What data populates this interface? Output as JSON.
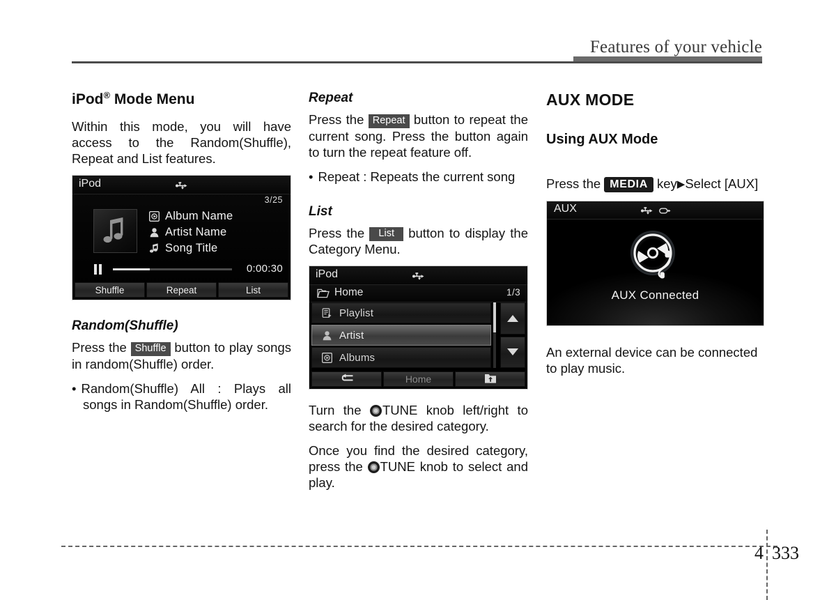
{
  "header": {
    "title": "Features of your vehicle"
  },
  "footer": {
    "chapter": "4",
    "page": "333"
  },
  "left_column": {
    "section_title": "iPod",
    "section_title_sup": "®",
    "section_title_rest": " Mode Menu",
    "intro": "Within this mode, you will have access to the Random(Shuffle), Repeat and List features.",
    "ipod_screen": {
      "title": "iPod",
      "usb_icon": "usb-icon",
      "track_count": "3/25",
      "album_icon": "album-icon",
      "album_label": "Album Name",
      "artist_icon": "artist-icon",
      "artist_label": "Artist Name",
      "song_icon": "music-note-icon",
      "song_label": "Song Title",
      "pause_icon": "pause-icon",
      "progress_percent": 31,
      "elapsed": "0:00:30",
      "softkeys": [
        "Shuffle",
        "Repeat",
        "List"
      ]
    },
    "random_heading": "Random(Shuffle)",
    "random_text_before": "Press the ",
    "random_key": "Shuffle",
    "random_text_after": " button to play songs in random(Shuffle) order.",
    "random_bullets": [
      "Random(Shuffle) All : Plays all songs in Random(Shuffle) order."
    ]
  },
  "mid_column": {
    "repeat_heading": "Repeat",
    "repeat_text_before": "Press the ",
    "repeat_key": "Repeat",
    "repeat_text_after": " button to repeat the current song. Press the button again to turn the repeat feature off.",
    "repeat_bullets": [
      "Repeat : Repeats the current song"
    ],
    "list_heading": "List",
    "list_text_before": "Press the ",
    "list_key": "List",
    "list_text_after": " button to display the Category Menu.",
    "list_screen": {
      "title": "iPod",
      "usb_icon": "usb-icon",
      "folder_icon": "folder-icon",
      "path": "Home",
      "page_indicator": "1/3",
      "rows": [
        {
          "icon": "playlist-icon",
          "label": "Playlist",
          "selected": false
        },
        {
          "icon": "artist-icon",
          "label": "Artist",
          "selected": true
        },
        {
          "icon": "album-icon",
          "label": "Albums",
          "selected": false
        }
      ],
      "scroll_up_icon": "triangle-up-icon",
      "scroll_down_icon": "triangle-down-icon",
      "bottom_keys": [
        {
          "icon": "back-arrow-icon",
          "label": ""
        },
        {
          "icon": "",
          "label": "Home"
        },
        {
          "icon": "folder-up-icon",
          "label": ""
        }
      ]
    },
    "tune_para_1_a": "Turn the ",
    "tune_knob_icon": "tune-knob-icon",
    "tune_para_1_b": "TUNE knob left/right to search for the desired category.",
    "tune_para_2_a": "Once you find the desired category, press the ",
    "tune_para_2_b": "TUNE knob to select and play."
  },
  "right_column": {
    "mode_title": "AUX MODE",
    "using_title": "Using AUX Mode",
    "press_text_before": "Press the ",
    "media_key": "MEDIA",
    "press_text_mid": " key",
    "arrow": "▶",
    "press_text_after": "Select [AUX]",
    "aux_screen": {
      "title": "AUX",
      "usb_icon": "usb-icon",
      "aux_plug_icon": "aux-plug-icon",
      "disc_icon": "aux-disc-icon",
      "caption": "AUX Connected"
    },
    "note": "An external device can be connected to play music."
  },
  "colors": {
    "text": "#151515",
    "chip_bg": "#4a4a4a",
    "header_rule": "#6b6b6b",
    "screen_bg": "#000000"
  }
}
